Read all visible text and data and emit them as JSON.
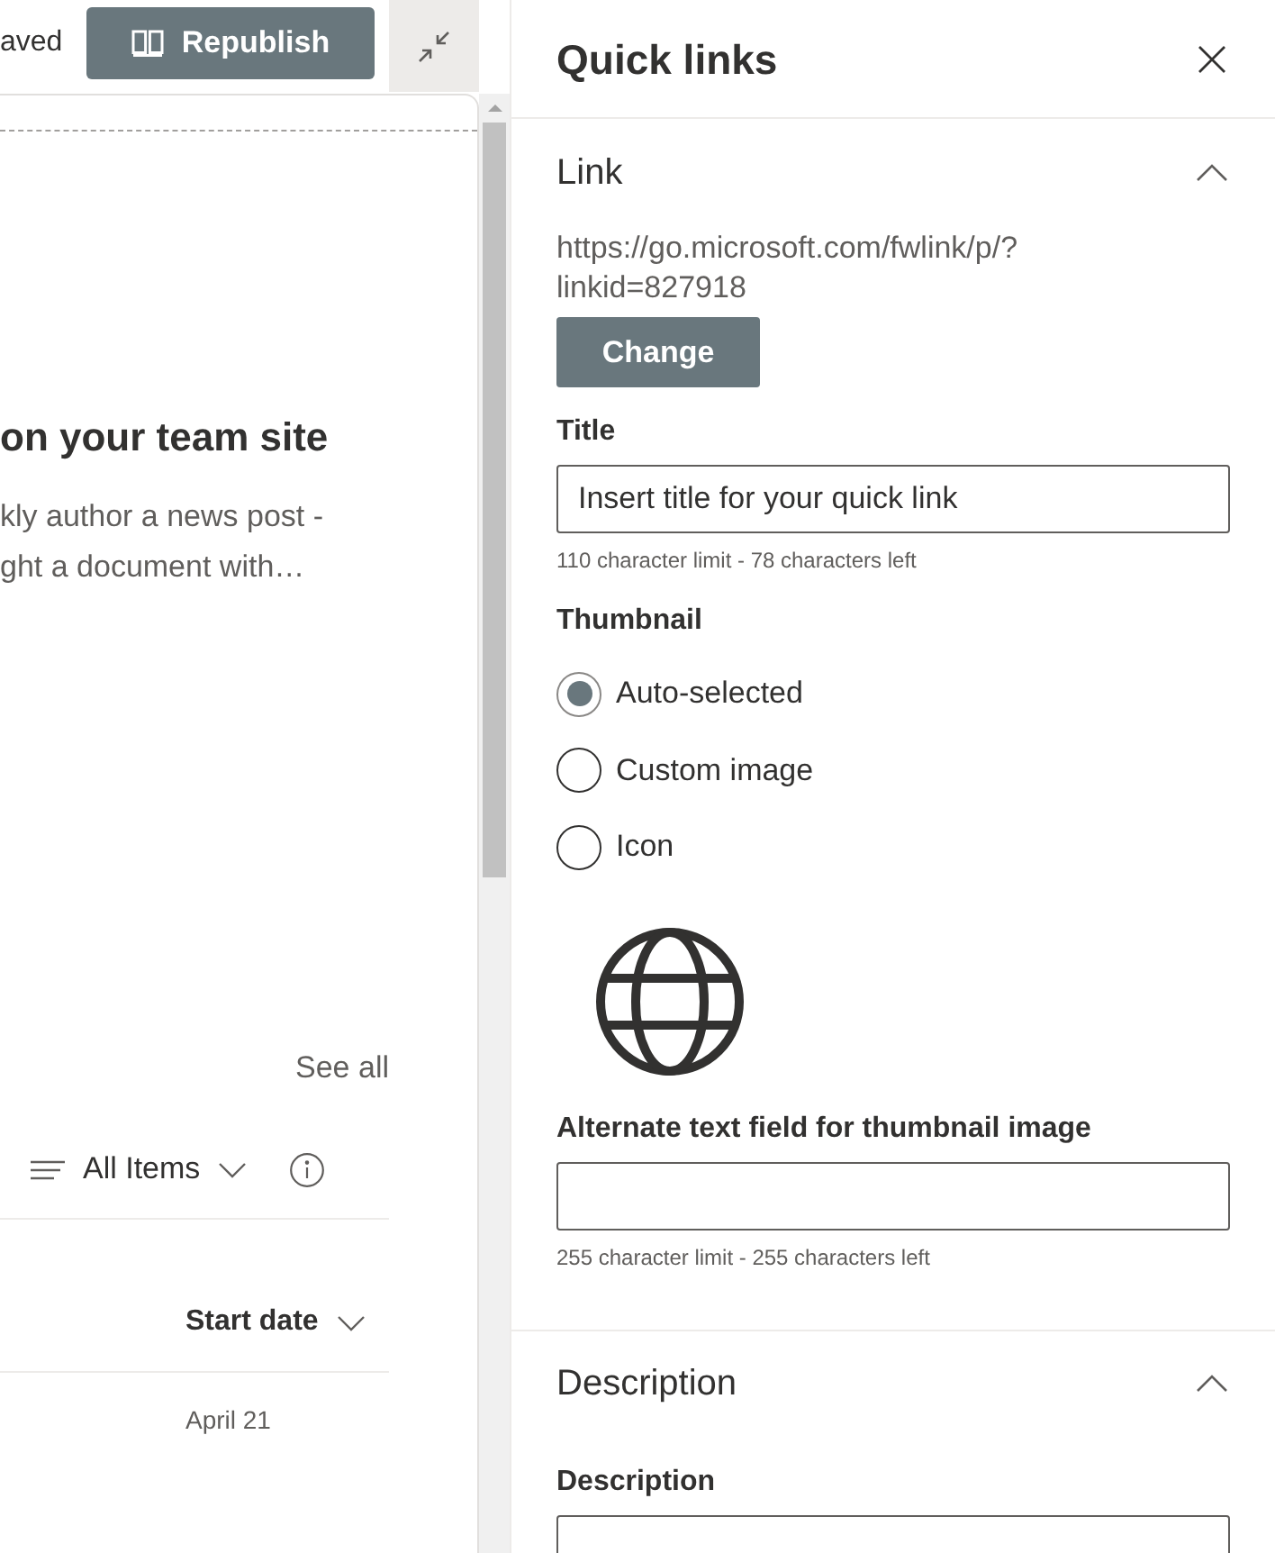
{
  "page_toolbar": {
    "status_text": "aved",
    "republish_button": "Republish"
  },
  "page_content": {
    "heading": "on your team site",
    "description_lines": [
      "kly author a news post -",
      "ght a document with…"
    ],
    "see_all_link": "See all",
    "view_selector": "All Items",
    "list": {
      "columns": [
        {
          "label": "Start date"
        }
      ],
      "rows": [
        {
          "cells": [
            "April 21"
          ]
        }
      ]
    }
  },
  "panel": {
    "title": "Quick links",
    "sections": [
      {
        "title": "Link",
        "expanded": true,
        "items": [
          {
            "kind": "url",
            "text": "https://go.microsoft.com/fwlink/p/?linkid=827918"
          },
          {
            "kind": "button",
            "label": "Change"
          },
          {
            "kind": "text_field",
            "label": "Title",
            "value": "Insert title for your quick link",
            "hint": "110 character limit - 78 characters left"
          },
          {
            "kind": "radio_group",
            "label": "Thumbnail",
            "options": [
              {
                "label": "Auto-selected",
                "selected": true
              },
              {
                "label": "Custom image",
                "selected": false
              },
              {
                "label": "Icon",
                "selected": false
              }
            ]
          },
          {
            "kind": "icon_preview"
          },
          {
            "kind": "text_field",
            "label": "Alternate text field for thumbnail image",
            "hint": "255 character limit - 255 characters left"
          }
        ]
      },
      {
        "title": "Description",
        "expanded": true,
        "items": [
          {
            "kind": "text_field",
            "label": "Description"
          }
        ]
      }
    ]
  }
}
